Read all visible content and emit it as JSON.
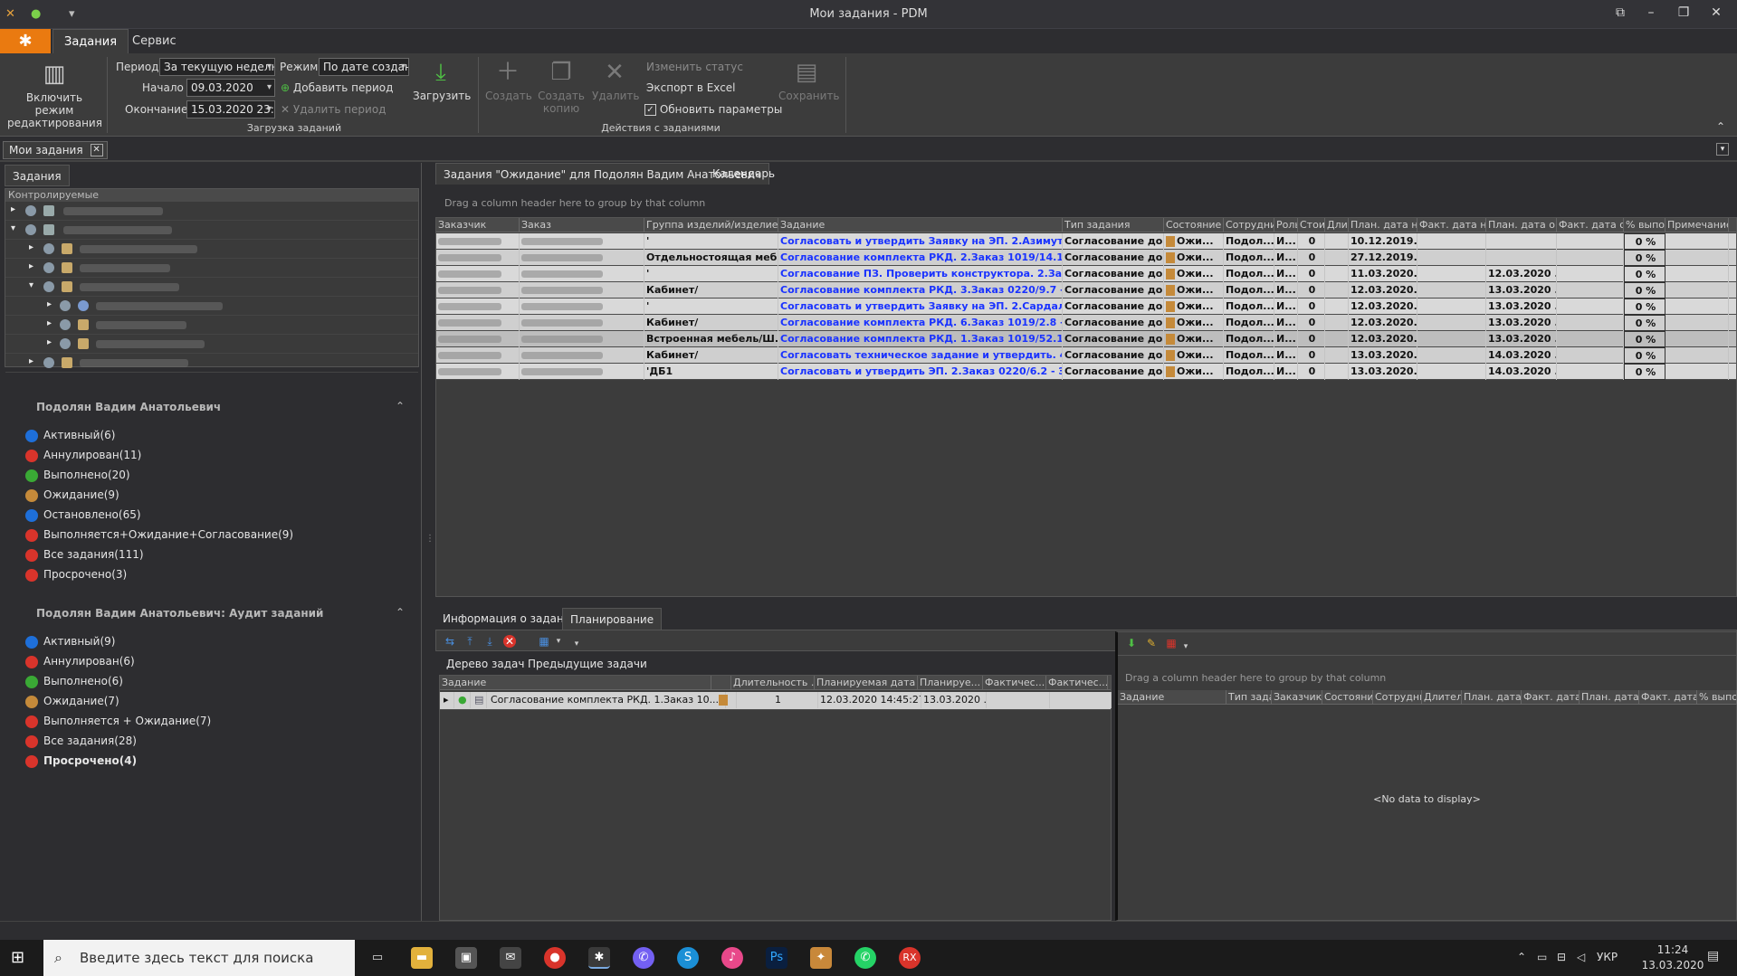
{
  "window": {
    "title": "Мои задания - PDM"
  },
  "ribbon": {
    "tabs": [
      "Задания",
      "Сервис"
    ],
    "edit_mode_label": "Включить режим редактирования",
    "period_label": "Период",
    "period_value": "За текущую неделю",
    "mode_label": "Режим",
    "mode_value": "По дате создан",
    "start_label": "Начало",
    "start_value": "09.03.2020",
    "end_label": "Окончание",
    "end_value": "15.03.2020 23:5",
    "add_period": "Добавить период",
    "remove_period": "Удалить период",
    "load_label": "Загрузить",
    "group_load": "Загрузка заданий",
    "create": "Создать",
    "create_copy": "Создать копию",
    "delete": "Удалить",
    "change_status": "Изменить статус",
    "export_excel": "Экспорт в Excel",
    "update_params": "Обновить параметры",
    "save": "Сохранить",
    "group_actions": "Действия с заданиями"
  },
  "doc_tab": "Мои задания",
  "left": {
    "tab": "Задания",
    "tree_header": "Контролируемые",
    "section1": {
      "title": "Подолян Вадим Анатольевич",
      "items": [
        {
          "label": "Активный(6)",
          "color": "#1e6fd9"
        },
        {
          "label": "Аннулирован(11)",
          "color": "#d9342b"
        },
        {
          "label": "Выполнено(20)",
          "color": "#3aa935"
        },
        {
          "label": "Ожидание(9)",
          "color": "#c58a3a"
        },
        {
          "label": "Остановлено(65)",
          "color": "#1e6fd9"
        },
        {
          "label": "Выполняется+Ожидание+Согласование(9)",
          "color": "#d9342b"
        },
        {
          "label": "Все задания(111)",
          "color": "#d9342b"
        },
        {
          "label": "Просрочено(3)",
          "color": "#d9342b"
        }
      ]
    },
    "section2": {
      "title": "Подолян Вадим Анатольевич: Аудит заданий",
      "items": [
        {
          "label": "Активный(9)",
          "color": "#1e6fd9"
        },
        {
          "label": "Аннулирован(6)",
          "color": "#d9342b"
        },
        {
          "label": "Выполнено(6)",
          "color": "#3aa935"
        },
        {
          "label": "Ожидание(7)",
          "color": "#c58a3a"
        },
        {
          "label": "Выполняется + Ожидание(7)",
          "color": "#d9342b"
        },
        {
          "label": "Все задания(28)",
          "color": "#d9342b"
        },
        {
          "label": "Просрочено(4)",
          "color": "#d9342b"
        }
      ]
    }
  },
  "main": {
    "tabs": [
      "Задания \"Ожидание\" для Подолян Вадим Анатольевич",
      "Календарь"
    ],
    "group_hint": "Drag a column header here to group by that column",
    "columns": [
      "Заказчик",
      "Заказ",
      "Группа изделий/изделие",
      "Задание",
      "Тип задания",
      "Состояние",
      "Сотрудник",
      "Роль",
      "Стои",
      "Дли",
      "План. дата на",
      "Факт. дата на",
      "План. дата око",
      "Факт. дата ок",
      "% выпол",
      "Примечание"
    ],
    "rows": [
      {
        "group": "'",
        "task": "Согласовать и утвердить Заявку на ЭП. 2.Азимут - ...",
        "type": "Согласование до...",
        "state": "Ожи...",
        "emp": "Подол...",
        "role": "И...",
        "cost": "0",
        "plan_start": "10.12.2019...",
        "plan_end": "",
        "pct": "0 %"
      },
      {
        "group": "Отдельностоящая меб...",
        "task": "Согласование комплекта РКД. 2.Заказ 1019/14.1.4 ...",
        "type": "Согласование до...",
        "state": "Ожи...",
        "emp": "Подол...",
        "role": "И...",
        "cost": "0",
        "plan_start": "27.12.2019...",
        "plan_end": "",
        "pct": "0 %"
      },
      {
        "group": "'",
        "task": "Согласование ПЗ. Проверить конструктора. 2.Зака...",
        "type": "Согласование до...",
        "state": "Ожи...",
        "emp": "Подол...",
        "role": "И...",
        "cost": "0",
        "plan_start": "11.03.2020...",
        "plan_end": "12.03.2020 ...",
        "pct": "0 %"
      },
      {
        "group": "Кабинет/",
        "task": "Согласование комплекта РКД. 3.Заказ 0220/9.7 - Р...",
        "type": "Согласование до...",
        "state": "Ожи...",
        "emp": "Подол...",
        "role": "И...",
        "cost": "0",
        "plan_start": "12.03.2020...",
        "plan_end": "13.03.2020 ...",
        "pct": "0 %"
      },
      {
        "group": "'",
        "task": "Согласовать и утвердить Заявку на ЭП. 2.Сардало...",
        "type": "Согласование до...",
        "state": "Ожи...",
        "emp": "Подол...",
        "role": "И...",
        "cost": "0",
        "plan_start": "12.03.2020...",
        "plan_end": "13.03.2020 ...",
        "pct": "0 %"
      },
      {
        "group": "Кабинет/",
        "task": "Согласование комплекта РКД. 6.Заказ 1019/2.8 - Р...",
        "type": "Согласование до...",
        "state": "Ожи...",
        "emp": "Подол...",
        "role": "И...",
        "cost": "0",
        "plan_start": "12.03.2020...",
        "plan_end": "13.03.2020 ...",
        "pct": "0 %"
      },
      {
        "group": "Встроенная мебель/Ш...",
        "task": "Согласование комплекта РКД. 1.Заказ 1019/52.1.1 ...",
        "type": "Согласование до...",
        "state": "Ожи...",
        "emp": "Подол...",
        "role": "И...",
        "cost": "0",
        "plan_start": "12.03.2020...",
        "plan_end": "13.03.2020 ...",
        "pct": "0 %"
      },
      {
        "group": "Кабинет/",
        "task": "Согласовать техническое задание и утвердить. 4....",
        "type": "Согласование до...",
        "state": "Ожи...",
        "emp": "Подол...",
        "role": "И...",
        "cost": "0",
        "plan_start": "13.03.2020...",
        "plan_end": "14.03.2020 ...",
        "pct": "0 %"
      },
      {
        "group": "'ДБ1",
        "task": "Согласовать и утвердить ЭП. 2.Заказ 0220/6.2 - ЭП",
        "type": "Согласование до...",
        "state": "Ожи...",
        "emp": "Подол...",
        "role": "И...",
        "cost": "0",
        "plan_start": "13.03.2020...",
        "plan_end": "14.03.2020 ...",
        "pct": "0 %"
      }
    ]
  },
  "lower": {
    "tabs": [
      "Информация о задании",
      "Планирование"
    ],
    "subtabs": [
      "Дерево задач",
      "Предыдущие задачи"
    ],
    "tree_columns": [
      "Задание",
      "",
      "Длительность ...",
      "Планируемая дата ...",
      "Планируе...",
      "Фактичес...",
      "Фактичес..."
    ],
    "tree_row": {
      "task": "Согласование комплекта РКД. 1.Заказ 10...",
      "duration": "1",
      "plan_date": "12.03.2020 14:45:27",
      "plan2": "13.03.2020 ..."
    },
    "group_hint": "Drag a column header here to group by that column",
    "right_columns": [
      "Задание",
      "Тип зада",
      "Заказчик",
      "Состояни",
      "Сотрудни",
      "Длител",
      "План. дата н",
      "Факт. дата",
      "План. дата",
      "Факт. дата",
      "% выпо"
    ],
    "no_data": "<No data to display>"
  },
  "taskbar": {
    "search_placeholder": "Введите здесь текст для поиска",
    "lang": "УКР",
    "time": "11:24",
    "date": "13.03.2020"
  }
}
